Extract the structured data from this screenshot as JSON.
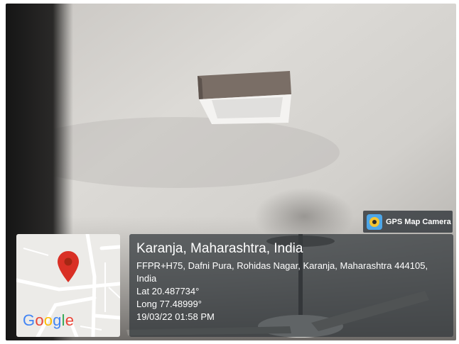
{
  "overlay": {
    "app_badge": {
      "name": "GPS Map Camera",
      "icon": "gps-map-camera-icon"
    },
    "location": {
      "title": "Karanja, Maharashtra, India",
      "address": "FFPR+H75, Dafni Pura, Rohidas Nagar, Karanja, Maharashtra 444105, India",
      "latitude": "Lat 20.487734°",
      "longitude": "Long 77.48999°",
      "timestamp": "19/03/22 01:58 PM"
    },
    "map": {
      "logo_text": "Google",
      "pin_icon": "map-pin-icon",
      "pin_color": "#d93025",
      "logo_colors": [
        "#4285f4",
        "#ea4335",
        "#fbbc05",
        "#4285f4",
        "#34a853",
        "#ea4335"
      ]
    }
  },
  "scene": {
    "subjects": [
      "ceiling-light-fixture",
      "ceiling-fan"
    ],
    "colors": {
      "ceiling": "#d6d4d0",
      "wall_edge": "#1c1c1c"
    }
  }
}
